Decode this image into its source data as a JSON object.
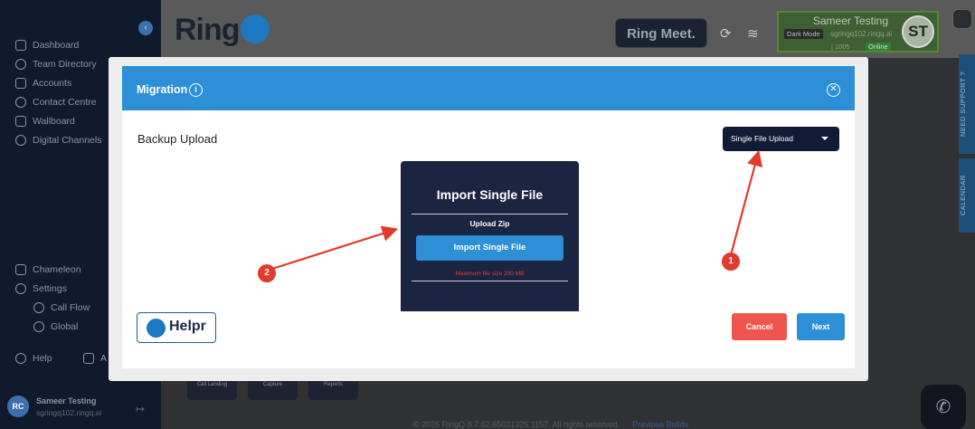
{
  "sidebar": {
    "items": [
      {
        "label": "Dashboard"
      },
      {
        "label": "Team Directory"
      },
      {
        "label": "Accounts"
      },
      {
        "label": "Contact Centre"
      },
      {
        "label": "Wallboard"
      },
      {
        "label": "Digital Channels"
      },
      {
        "label": "Chameleon"
      },
      {
        "label": "Settings"
      },
      {
        "label": "Call Flow"
      },
      {
        "label": "Global"
      },
      {
        "label": "Help"
      },
      {
        "label": "A"
      }
    ],
    "user": {
      "initials": "RC",
      "name": "Sameer Testing",
      "email": "sgringq102.ringq.ai"
    }
  },
  "header": {
    "logo_text": "Ring",
    "meet_label": "Ring Meet.",
    "user": {
      "name": "Sameer Testing",
      "mode": "Dark Mode",
      "email": "sgringq102.ringq.ai",
      "extension": "| 1005",
      "status": "Online",
      "initials": "ST"
    },
    "side_tabs": [
      "NEED SUPPORT ?",
      "CALENDAR"
    ]
  },
  "bottom_tiles": [
    "Call Landing",
    "Capture",
    "Reports"
  ],
  "footer": {
    "text": "© 2026 RingQ 8.7.62.65031326.1157. All rights reserved.",
    "link": "Previous Builds"
  },
  "modal": {
    "title": "Migration",
    "section_title": "Backup Upload",
    "select": {
      "value": "Single File Upload"
    },
    "card": {
      "title": "Import Single File",
      "upload_label": "Upload Zip",
      "button_label": "Import Single File",
      "max_size": "Maximum file size 200 MB"
    },
    "helpr_label": "Helpr",
    "cancel_label": "Cancel",
    "next_label": "Next"
  },
  "annotations": [
    {
      "label": "1"
    },
    {
      "label": "2"
    }
  ],
  "colors": {
    "header_blue": "#2d8fd6",
    "card_navy": "#1b2440",
    "cancel_red": "#ee554f",
    "annotation_red": "#e23a2b"
  }
}
